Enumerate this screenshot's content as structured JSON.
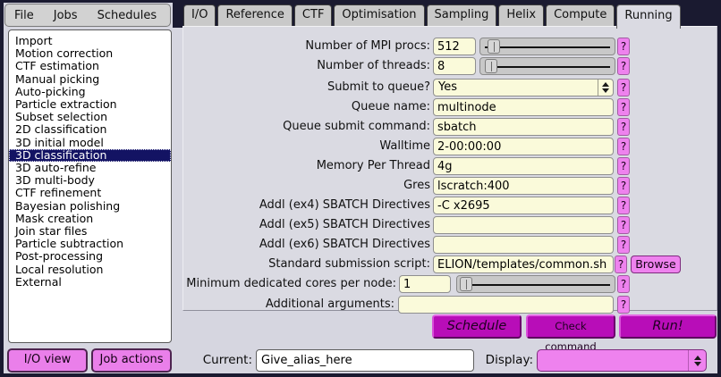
{
  "menubar": {
    "items": [
      "File",
      "Jobs",
      "Schedules"
    ]
  },
  "job_list": {
    "selected_index": 9,
    "items": [
      "Import",
      "Motion correction",
      "CTF estimation",
      "Manual picking",
      "Auto-picking",
      "Particle extraction",
      "Subset selection",
      "2D classification",
      "3D initial model",
      "3D classification",
      "3D auto-refine",
      "3D multi-body",
      "CTF refinement",
      "Bayesian polishing",
      "Mask creation",
      "Join star files",
      "Particle subtraction",
      "Post-processing",
      "Local resolution",
      "External"
    ]
  },
  "tabs": {
    "active": "Running",
    "items": [
      "I/O",
      "Reference",
      "CTF",
      "Optimisation",
      "Sampling",
      "Helix",
      "Compute",
      "Running"
    ]
  },
  "form": {
    "help_label": "?",
    "browse_label": "Browse",
    "rows": [
      {
        "label": "Number of MPI procs:",
        "value": "512",
        "type": "entry-slider"
      },
      {
        "label": "Number of threads:",
        "value": "8",
        "type": "entry-slider"
      },
      {
        "label": "Submit to queue?",
        "value": "Yes",
        "type": "choice"
      },
      {
        "label": "Queue name:",
        "value": "multinode",
        "type": "text"
      },
      {
        "label": "Queue submit command:",
        "value": "sbatch",
        "type": "text"
      },
      {
        "label": "Walltime",
        "value": "2-00:00:00",
        "type": "text"
      },
      {
        "label": "Memory Per Thread",
        "value": "4g",
        "type": "text"
      },
      {
        "label": "Gres",
        "value": "lscratch:400",
        "type": "text"
      },
      {
        "label": "Addl (ex4) SBATCH Directives",
        "value": "-C x2695",
        "type": "text"
      },
      {
        "label": "Addl (ex5) SBATCH Directives",
        "value": "",
        "type": "text"
      },
      {
        "label": "Addl (ex6) SBATCH Directives",
        "value": "",
        "type": "text"
      },
      {
        "label": "Standard submission script:",
        "value": "ELION/templates/common.sh",
        "type": "file"
      },
      {
        "label": "Minimum dedicated cores per node:",
        "value": "1",
        "type": "entry-slider"
      },
      {
        "label": "Additional arguments:",
        "value": "",
        "type": "text-wide"
      }
    ]
  },
  "actions": {
    "schedule_label": "Schedule",
    "check_label": "Check command",
    "run_label": "Run!"
  },
  "footer": {
    "io_view_label": "I/O view",
    "job_actions_label": "Job actions",
    "current_label": "Current:",
    "current_value": "Give_alias_here",
    "display_label": "Display:",
    "display_value": ""
  },
  "colors": {
    "frame": "#1a1a30",
    "panel_bg": "#dadae2",
    "entry_bg": "#fafada",
    "selection_navy": "#131363",
    "violet": "#ee82ee",
    "magenta": "#b80db8"
  }
}
